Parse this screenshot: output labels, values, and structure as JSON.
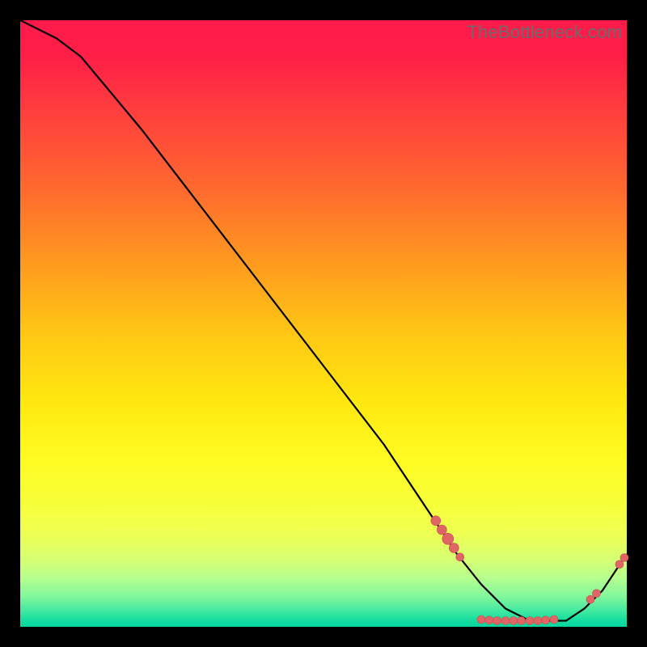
{
  "watermark": "TheBottleneck.com",
  "colors": {
    "marker": "#e06666",
    "marker_stroke": "#c44d4d",
    "line": "#000000"
  },
  "chart_data": {
    "type": "line",
    "title": "",
    "xlabel": "",
    "ylabel": "",
    "xlim": [
      0,
      100
    ],
    "ylim": [
      0,
      100
    ],
    "series": [
      {
        "name": "curve",
        "x": [
          0,
          6,
          10,
          20,
          30,
          40,
          50,
          60,
          68,
          72,
          76,
          80,
          84,
          88,
          90,
          93,
          96,
          100
        ],
        "y": [
          100,
          97,
          94,
          82,
          69,
          56,
          43,
          30,
          18,
          12,
          7,
          3,
          1,
          1,
          1,
          3,
          6,
          12
        ]
      }
    ],
    "markers": [
      {
        "x": 68.5,
        "y": 17.5,
        "r": 6
      },
      {
        "x": 69.5,
        "y": 16.0,
        "r": 6
      },
      {
        "x": 70.5,
        "y": 14.5,
        "r": 7
      },
      {
        "x": 71.5,
        "y": 13.0,
        "r": 6
      },
      {
        "x": 72.5,
        "y": 11.5,
        "r": 5
      },
      {
        "x": 76.0,
        "y": 1.2,
        "r": 5
      },
      {
        "x": 77.3,
        "y": 1.1,
        "r": 5
      },
      {
        "x": 78.6,
        "y": 1.0,
        "r": 5
      },
      {
        "x": 80.0,
        "y": 1.0,
        "r": 5
      },
      {
        "x": 81.3,
        "y": 1.0,
        "r": 5
      },
      {
        "x": 82.6,
        "y": 1.0,
        "r": 5
      },
      {
        "x": 84.0,
        "y": 1.0,
        "r": 5
      },
      {
        "x": 85.3,
        "y": 1.0,
        "r": 5
      },
      {
        "x": 86.6,
        "y": 1.1,
        "r": 5
      },
      {
        "x": 88.0,
        "y": 1.2,
        "r": 5
      },
      {
        "x": 94.0,
        "y": 4.5,
        "r": 5
      },
      {
        "x": 95.0,
        "y": 5.5,
        "r": 5
      },
      {
        "x": 98.8,
        "y": 10.3,
        "r": 5
      },
      {
        "x": 99.6,
        "y": 11.4,
        "r": 5
      }
    ]
  }
}
